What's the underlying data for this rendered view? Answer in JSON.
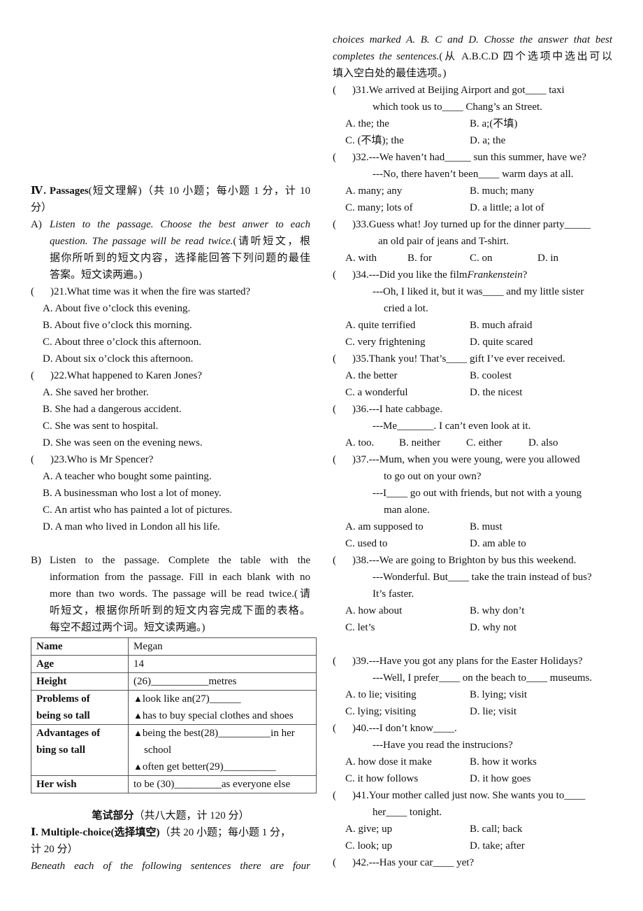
{
  "left": {
    "section4": {
      "title_roman": "Ⅳ.",
      "title_bold": "Passages",
      "title_rest_line1": "(短文理解)（共 10 小题；每小题 1 分，计 10",
      "title_rest_line2": "分）"
    },
    "partA": {
      "label": "A)",
      "instructions_lines": [
        "Listen to the passage. Choose the best anwer to each",
        "question. The passage will be read twice."
      ],
      "instructions_cn_tail": "(请听短文，根",
      "instructions_cn_lines": [
        "据你所听到的短文内容，选择能回答下列问题的最佳",
        "答案。短文读两遍。)"
      ]
    },
    "questions": [
      {
        "number": ")21.",
        "text": " What time was it when the fire was started?",
        "options": [
          "A. About five o’clock this evening.",
          "B. About five o’clock this morning.",
          "C. About three o’clock this afternoon.",
          "D. About six o’clock this afternoon."
        ]
      },
      {
        "number": ")22.",
        "text": " What happened to Karen Jones?",
        "options": [
          "A. She saved her brother.",
          "B. She had a dangerous accident.",
          "C. She was sent to hospital.",
          "D. She was seen on the evening news."
        ]
      },
      {
        "number": ")23.",
        "text": " Who is Mr Spencer?",
        "options": [
          "A. A teacher who bought some painting.",
          "B. A businessman who lost a lot of money.",
          "C. An artist who has painted a lot of pictures.",
          "D. A man who lived in London all his life."
        ]
      }
    ],
    "partB": {
      "label": "B)",
      "lines": [
        "Listen to the passage. Complete the table with the",
        "information from the passage. Fill in each blank with no",
        "more than two words. The passage will be read twice.(请",
        "听短文，根据你所听到的短文内容完成下面的表格。",
        "每空不超过两个词。短文读两遍。)"
      ]
    },
    "table": {
      "rows": [
        {
          "key": "Name",
          "values": [
            "Megan"
          ]
        },
        {
          "key": "Age",
          "values": [
            "14"
          ]
        },
        {
          "key": "Height",
          "values": [
            "(26)___________metres"
          ]
        },
        {
          "key_lines": [
            "Problems of",
            "being so tall"
          ],
          "values": [
            "look like an(27)______",
            "has to buy special clothes and shoes"
          ]
        },
        {
          "key_lines": [
            "Advantages of",
            "bing so tall"
          ],
          "values": [
            "being the best(28)__________in her",
            "school",
            "often get better(29)__________"
          ]
        },
        {
          "key": "Her wish",
          "values": [
            "to be (30)_________as everyone else"
          ]
        }
      ],
      "bullet": "▲"
    },
    "written": {
      "heading_bold": "笔试部分",
      "heading_rest": "（共八大题，计 120 分）"
    },
    "section1": {
      "title_roman": "Ⅰ.",
      "title_bold": " Multiple-choice(选择填空)",
      "title_rest_line1": "（共 20 小题；每小题 1 分，",
      "title_rest_line2": "计 20 分）",
      "instr_line1": "Beneath each of the following sentences there are four"
    }
  },
  "right": {
    "instr_line2": "choices marked A. B. C and D. Chosse the answer that best",
    "instr_line3_italic": "completes the sentences.",
    "instr_line3_cn": "(从 A.B.C.D 四个选项中选出可以",
    "instr_line4_cn": "填入空白处的最佳选项。)",
    "paren": "(",
    "questions": [
      {
        "number": ")31.",
        "lines": [
          " We arrived at Beijing Airport and got____ taxi",
          "which took us to____ Chang’s an Street."
        ],
        "options": [
          "A. the; the",
          "B. a;(不填)",
          "C. (不填); the",
          "D. a; the"
        ]
      },
      {
        "number": ")32.",
        "lines": [
          " ---We haven’t had_____ sun this summer, have we?",
          "---No, there haven’t been____ warm days at all."
        ],
        "options": [
          "A. many; any",
          "B. much; many",
          "C. many; lots of",
          "D. a little; a lot of"
        ]
      },
      {
        "number": ")33.",
        "lines": [
          " Guess what! Joy turned up for the dinner party_____",
          "an old pair of jeans and T-shirt."
        ],
        "options": [
          "A. with",
          "B. for",
          "C. on",
          "D. in"
        ]
      },
      {
        "number": ")34.",
        "line1_pre": " ---Did you like the film ",
        "line1_italic": "Frankenstein",
        "line1_post": "?",
        "lines": [
          "---Oh, I liked it, but it was____ and my little sister",
          "cried a lot."
        ],
        "options": [
          "A. quite terrified",
          "B. much afraid",
          "C. very frightening",
          "D. quite scared"
        ]
      },
      {
        "number": ")35.",
        "lines": [
          " Thank you! That’s____ gift I’ve ever received."
        ],
        "options": [
          "A. the better",
          "B. coolest",
          "C. a wonderful",
          "D. the nicest"
        ]
      },
      {
        "number": ")36.",
        "lines": [
          " ---I hate cabbage.",
          "---Me_______. I can’t even look at it."
        ],
        "options": [
          "A. too.",
          "B. neither",
          "C. either",
          "D. also"
        ]
      },
      {
        "number": ")37.",
        "lines": [
          "---Mum, when you were young, were you allowed",
          "to go out on your own?",
          "---I____ go out with friends, but not with a young",
          "man alone."
        ],
        "options": [
          "A. am supposed to",
          "B. must",
          "C. used to",
          "D. am able to"
        ]
      },
      {
        "number": ")38.",
        "lines": [
          "---We are going to Brighton by bus this weekend.",
          "---Wonderful. But____ take the train instead of bus?",
          "It’s faster."
        ],
        "options": [
          "A. how about",
          "B. why don’t",
          "C. let’s",
          "D. why not"
        ]
      },
      {
        "number": ")39.",
        "lines": [
          " ---Have you got any plans for the Easter Holidays?",
          "---Well, I prefer____ on the beach to____ museums."
        ],
        "options": [
          "A. to lie; visiting",
          "B. lying; visit",
          "C. lying; visiting",
          "D. lie; visit"
        ]
      },
      {
        "number": ")40.",
        "lines": [
          " ---I don’t know____.",
          "---Have you read the instrucions?"
        ],
        "options": [
          "A. how dose it make",
          "B. how it works",
          "C. it how follows",
          "D. it how goes"
        ]
      },
      {
        "number": ")41.",
        "lines": [
          "Your mother called just now. She wants you to____",
          "her____ tonight."
        ],
        "options": [
          "A. give; up",
          "B. call; back",
          "C. look; up",
          "D. take; after"
        ]
      },
      {
        "number": ")42.",
        "lines": [
          "---Has your car____ yet?"
        ],
        "options": []
      }
    ]
  }
}
